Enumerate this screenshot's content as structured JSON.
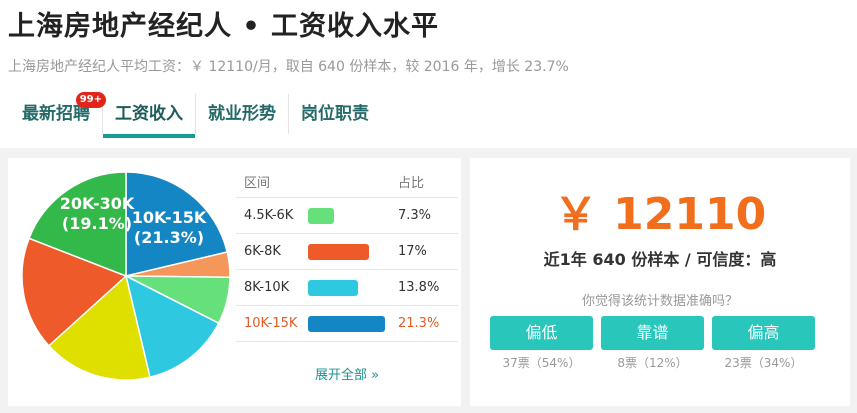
{
  "header": {
    "title": "上海房地产经纪人 • 工资收入水平",
    "subtitle": "上海房地产经纪人平均工资：￥ 12110/月，取自 640 份样本，较 2016 年，增长 23.7%"
  },
  "tabs": [
    {
      "label": "最新招聘",
      "badge": "99+"
    },
    {
      "label": "工资收入",
      "active": true
    },
    {
      "label": "就业形势"
    },
    {
      "label": "岗位职责"
    }
  ],
  "chart_data": {
    "type": "pie",
    "slices": [
      {
        "label": "10K-15K",
        "value": 21.3,
        "color": "#1586c4"
      },
      {
        "label": "",
        "value": 3.9,
        "color": "#f5965a"
      },
      {
        "label": "",
        "value": 7.3,
        "color": "#66e07a"
      },
      {
        "label": "",
        "value": 13.8,
        "color": "#2ec8e0"
      },
      {
        "label": "",
        "value": 17.0,
        "color": "#e0e000"
      },
      {
        "label": "",
        "value": 17.6,
        "color": "#ef5a2a"
      },
      {
        "label": "20K-30K",
        "value": 19.1,
        "color": "#33b84a"
      }
    ],
    "data_labels": [
      {
        "range": "10K-15K",
        "percent": "(21.3%)"
      },
      {
        "range": "20K-30K",
        "percent": "(19.1%)"
      }
    ]
  },
  "table": {
    "headers": [
      "区间",
      "占比"
    ],
    "rows": [
      {
        "range": "4.5K-6K",
        "percent": "7.3%",
        "value": 7.3,
        "color": "#66e07a",
        "highlight": false
      },
      {
        "range": "6K-8K",
        "percent": "17%",
        "value": 17.0,
        "color": "#ef5a2a",
        "highlight": false
      },
      {
        "range": "8K-10K",
        "percent": "13.8%",
        "value": 13.8,
        "color": "#2ec8e0",
        "highlight": false
      },
      {
        "range": "10K-15K",
        "percent": "21.3%",
        "value": 21.3,
        "color": "#1586c4",
        "highlight": true
      }
    ],
    "expand_label": "展开全部 »"
  },
  "summary": {
    "salary": "￥ 12110",
    "samples_text": "近1年 640 份样本 / 可信度：高",
    "question": "你觉得该统计数据准确吗？",
    "buttons": [
      {
        "label": "偏低",
        "votes": "37票（54%）"
      },
      {
        "label": "靠谱",
        "votes": "8票（12%）"
      },
      {
        "label": "偏高",
        "votes": "23票（34%）"
      }
    ]
  }
}
